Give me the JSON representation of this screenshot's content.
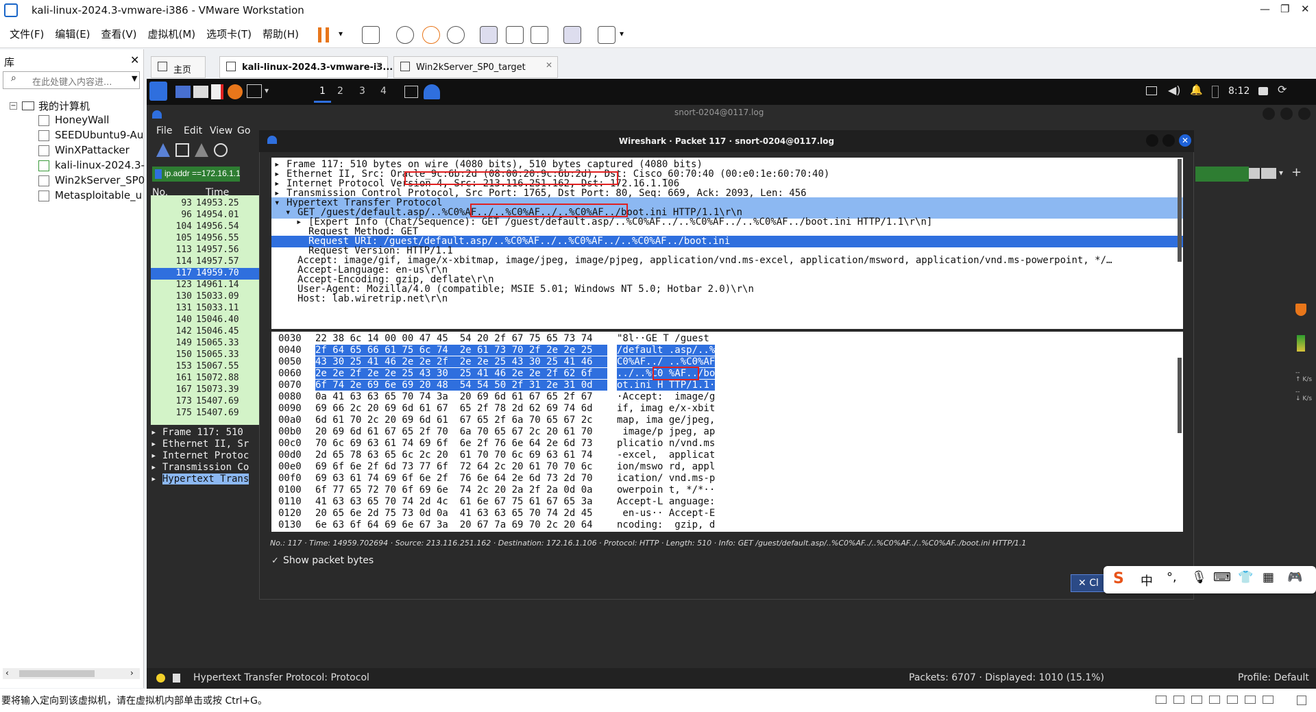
{
  "window": {
    "title": "kali-linux-2024.3-vmware-i386 - VMware Workstation"
  },
  "menu": [
    "文件(F)",
    "编辑(E)",
    "查看(V)",
    "虚拟机(M)",
    "选项卡(T)",
    "帮助(H)"
  ],
  "library": {
    "title": "库",
    "close": "✕",
    "search_placeholder": "在此处键入内容进...",
    "root": "我的计算机",
    "items": [
      "HoneyWall",
      "SEEDUbuntu9-Au",
      "WinXPattacker",
      "kali-linux-2024.3-",
      "Win2kServer_SP0",
      "Metasploitable_u"
    ]
  },
  "tabs": [
    {
      "label": "主页"
    },
    {
      "label": "kali-linux-2024.3-vmware-i3..."
    },
    {
      "label": "Win2kServer_SP0_target"
    }
  ],
  "kali": {
    "workspaces": [
      "1",
      "2",
      "3",
      "4"
    ],
    "clock": "8:12"
  },
  "bg_wireshark": {
    "title": "snort-0204@0117.log",
    "menu": [
      "File",
      "Edit",
      "View",
      "Go"
    ],
    "filter": "ip.addr ==172.16.1.10",
    "cols": [
      "No.",
      "Time"
    ],
    "rows": [
      [
        "93",
        "14953.25"
      ],
      [
        "96",
        "14954.01"
      ],
      [
        "104",
        "14956.54"
      ],
      [
        "105",
        "14956.55"
      ],
      [
        "113",
        "14957.56"
      ],
      [
        "114",
        "14957.57"
      ],
      [
        "117",
        "14959.70"
      ],
      [
        "123",
        "14961.14"
      ],
      [
        "130",
        "15033.09"
      ],
      [
        "131",
        "15033.11"
      ],
      [
        "140",
        "15046.40"
      ],
      [
        "142",
        "15046.45"
      ],
      [
        "149",
        "15065.33"
      ],
      [
        "150",
        "15065.33"
      ],
      [
        "153",
        "15067.55"
      ],
      [
        "161",
        "15072.88"
      ],
      [
        "167",
        "15073.39"
      ],
      [
        "173",
        "15407.69"
      ],
      [
        "175",
        "15407.69"
      ]
    ],
    "detail": [
      "Frame 117: 510",
      "Ethernet II, Sr",
      "Internet Protoc",
      "Transmission Co",
      "Hypertext Trans"
    ],
    "hex2": [
      [
        "00f0",
        "69 63 61 74 69 6f 6e 2f  76 6e 64 2e 6d 73 2d 70",
        "ication/ vnd.ms-p"
      ],
      [
        "0100",
        "6f 77 65 72 70 6f 69 6e  74 2c 20 2a 2f 2a 0d 0a",
        "owerpoin t, */*··"
      ],
      [
        "0110",
        "41 63 63 65 70 74 2d 4c  61 6e 67 75 61 67 65 3a",
        "Accept-L anguage:"
      ],
      [
        "0120",
        "20 65 6e 2d 75 73 0d 0a  41 63 63 65 70 74 2d 45",
        " en-us·· Accept-E"
      ],
      [
        "0130",
        "6e 63 6f 64 69 6e 67 3a  20 67 7a 69 70 2c 20 64",
        "ncoding:  gzip, d"
      ]
    ],
    "status_left": "Hypertext Transfer Protocol: Protocol",
    "status_mid": "Packets: 6707 · Displayed: 1010 (15.1%)",
    "status_right": "Profile: Default"
  },
  "dialog": {
    "title": "Wireshark · Packet 117 · snort-0204@0117.log",
    "tree": [
      "Frame 117: 510 bytes on wire (4080 bits), 510 bytes captured (4080 bits)",
      "Ethernet II, Src: Oracle_9c:6b:2d (08:00:20:9c:6b:2d), Dst: Cisco_60:70:40 (00:e0:1e:60:70:40)",
      "Internet Protocol Version 4, Src: 213.116.251.162, Dst: 172.16.1.106",
      "Transmission Control Protocol, Src Port: 1765, Dst Port: 80, Seq: 669, Ack: 2093, Len: 456",
      "Hypertext Transfer Protocol",
      "GET /guest/default.asp/..%C0%AF../..%C0%AF../..%C0%AF../boot.ini HTTP/1.1\\r\\n",
      "[Expert Info (Chat/Sequence): GET /guest/default.asp/..%C0%AF../..%C0%AF../..%C0%AF../boot.ini HTTP/1.1\\r\\n]",
      "Request Method: GET",
      "Request URI: /guest/default.asp/..%C0%AF../..%C0%AF../..%C0%AF../boot.ini",
      "Request Version: HTTP/1.1",
      "Accept: image/gif, image/x-xbitmap, image/jpeg, image/pjpeg, application/vnd.ms-excel, application/msword, application/vnd.ms-powerpoint, */…",
      "Accept-Language: en-us\\r\\n",
      "Accept-Encoding: gzip, deflate\\r\\n",
      "User-Agent: Mozilla/4.0 (compatible; MSIE 5.01; Windows NT 5.0; Hotbar 2.0)\\r\\n",
      "Host: lab.wiretrip.net\\r\\n"
    ],
    "hex": [
      [
        "0030",
        "22 38 6c 14 00 00 47 45  54 20 2f 67 75 65 73 74",
        "\"8l··GE T /guest"
      ],
      [
        "0040",
        "2f 64 65 66 61 75 6c 74  2e 61 73 70 2f 2e 2e 25",
        "/default .asp/..%"
      ],
      [
        "0050",
        "43 30 25 41 46 2e 2e 2f  2e 2e 25 43 30 25 41 46",
        "C0%AF../ ..%C0%AF"
      ],
      [
        "0060",
        "2e 2e 2f 2e 2e 25 43 30  25 41 46 2e 2e 2f 62 6f",
        "../..%C0 %AF../bo"
      ],
      [
        "0070",
        "6f 74 2e 69 6e 69 20 48  54 54 50 2f 31 2e 31 0d",
        "ot.ini H TTP/1.1·"
      ],
      [
        "0080",
        "0a 41 63 63 65 70 74 3a  20 69 6d 61 67 65 2f 67",
        "·Accept:  image/g"
      ],
      [
        "0090",
        "69 66 2c 20 69 6d 61 67  65 2f 78 2d 62 69 74 6d",
        "if, imag e/x-xbit"
      ],
      [
        "00a0",
        "6d 61 70 2c 20 69 6d 61  67 65 2f 6a 70 65 67 2c",
        "map, ima ge/jpeg,"
      ],
      [
        "00b0",
        "20 69 6d 61 67 65 2f 70  6a 70 65 67 2c 20 61 70",
        " image/p jpeg, ap"
      ],
      [
        "00c0",
        "70 6c 69 63 61 74 69 6f  6e 2f 76 6e 64 2e 6d 73",
        "plicatio n/vnd.ms"
      ],
      [
        "00d0",
        "2d 65 78 63 65 6c 2c 20  61 70 70 6c 69 63 61 74",
        "-excel,  applicat"
      ],
      [
        "00e0",
        "69 6f 6e 2f 6d 73 77 6f  72 64 2c 20 61 70 70 6c",
        "ion/mswo rd, appl"
      ],
      [
        "00f0",
        "69 63 61 74 69 6f 6e 2f  76 6e 64 2e 6d 73 2d 70",
        "ication/ vnd.ms-p"
      ],
      [
        "0100",
        "6f 77 65 72 70 6f 69 6e  74 2c 20 2a 2f 2a 0d 0a",
        "owerpoin t, */*··"
      ],
      [
        "0110",
        "41 63 63 65 70 74 2d 4c  61 6e 67 75 61 67 65 3a",
        "Accept-L anguage:"
      ],
      [
        "0120",
        "20 65 6e 2d 75 73 0d 0a  41 63 63 65 70 74 2d 45",
        " en-us·· Accept-E"
      ],
      [
        "0130",
        "6e 63 6f 64 69 6e 67 3a  20 67 7a 69 70 2c 20 64",
        "ncoding:  gzip, d"
      ]
    ],
    "info": "No.: 117 · Time: 14959.702694 · Source: 213.116.251.162 · Destination: 172.16.1.106 · Protocol: HTTP · Length: 510 · Info: GET /guest/default.asp/..%C0%AF../..%C0%AF../..%C0%AF../boot.ini HTTP/1.1",
    "show_bytes": "Show packet bytes",
    "close": "Cl"
  },
  "ime": {
    "lang": "中"
  },
  "host_status": "要将输入定向到该虚拟机，请在虚拟机内部单击或按 Ctrl+G。",
  "colors": {
    "selection": "#2f6fde",
    "selection_light": "#8cb8f2",
    "packet_green": "#d3f3c8",
    "highlight_red": "#e02020"
  }
}
